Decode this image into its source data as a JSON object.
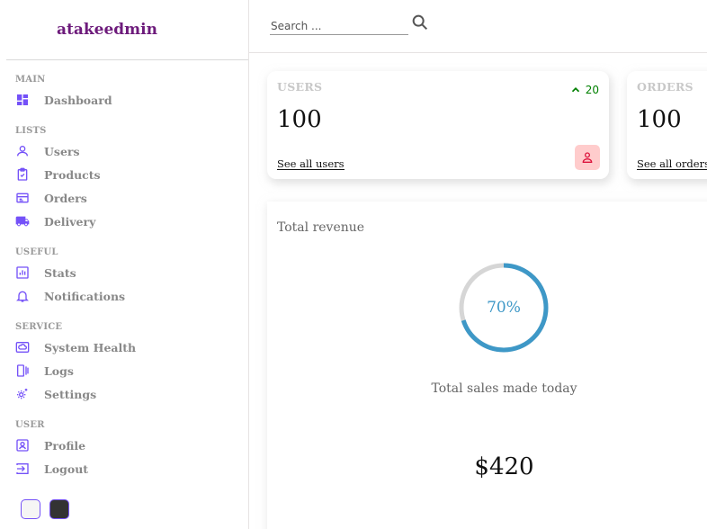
{
  "brand": {
    "name": "atakeedmin"
  },
  "sidebar": {
    "sections": [
      {
        "title": "MAIN",
        "items": [
          {
            "label": "Dashboard",
            "icon": "dashboard-icon"
          }
        ]
      },
      {
        "title": "LISTS",
        "items": [
          {
            "label": "Users",
            "icon": "user-icon"
          },
          {
            "label": "Products",
            "icon": "clipboard-icon"
          },
          {
            "label": "Orders",
            "icon": "credit-card-icon"
          },
          {
            "label": "Delivery",
            "icon": "truck-icon"
          }
        ]
      },
      {
        "title": "USEFUL",
        "items": [
          {
            "label": "Stats",
            "icon": "bar-chart-icon"
          },
          {
            "label": "Notifications",
            "icon": "bell-icon"
          }
        ]
      },
      {
        "title": "SERVICE",
        "items": [
          {
            "label": "System Health",
            "icon": "cloud-icon"
          },
          {
            "label": "Logs",
            "icon": "logs-icon"
          },
          {
            "label": "Settings",
            "icon": "gear-icon"
          }
        ]
      },
      {
        "title": "USER",
        "items": [
          {
            "label": "Profile",
            "icon": "profile-icon"
          },
          {
            "label": "Logout",
            "icon": "logout-icon"
          }
        ]
      }
    ],
    "icon_color": "#7451f8"
  },
  "topbar": {
    "search_placeholder": "Search ..."
  },
  "widgets": [
    {
      "title": "USERS",
      "count": "100",
      "link": "See all users",
      "percentage": "20",
      "trend": "up",
      "icon": "person-icon"
    },
    {
      "title": "ORDERS",
      "count": "100",
      "link": "See all orders"
    }
  ],
  "featured": {
    "title": "Total revenue",
    "progress_label": "70%",
    "progress": 70,
    "subtitle": "Total sales made today",
    "amount": "$420"
  },
  "theme": {
    "accent": "#7451f8",
    "progress_color": "#3e98c7",
    "positive": "#008000"
  }
}
